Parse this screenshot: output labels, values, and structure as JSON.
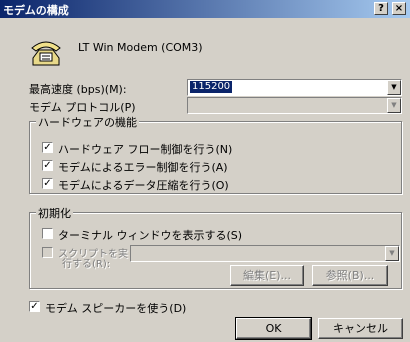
{
  "window": {
    "title": "モデムの構成",
    "help_button": "?",
    "close_button": "×"
  },
  "modem_name": "LT Win Modem (COM3)",
  "speed": {
    "label": "最高速度 (bps)(M):",
    "value": "115200"
  },
  "protocol": {
    "label": "モデム プロトコル(P)",
    "value": ""
  },
  "hardware_group": {
    "title": "ハードウェアの機能",
    "items": [
      {
        "label": "ハードウェア フロー制御を行う(N)",
        "checked": true
      },
      {
        "label": "モデムによるエラー制御を行う(A)",
        "checked": true
      },
      {
        "label": "モデムによるデータ圧縮を行う(O)",
        "checked": true
      }
    ]
  },
  "init_group": {
    "title": "初期化",
    "terminal_label": "ターミナル ウィンドウを表示する(S)",
    "script_label_line1": "スクリプトを実",
    "script_label_line2": "行する(R):",
    "edit_button": "編集(E)...",
    "browse_button": "参照(B)..."
  },
  "speaker": {
    "label": "モデム スピーカーを使う(D)",
    "checked": true
  },
  "ok_button": "OK",
  "cancel_button": "キャンセル"
}
